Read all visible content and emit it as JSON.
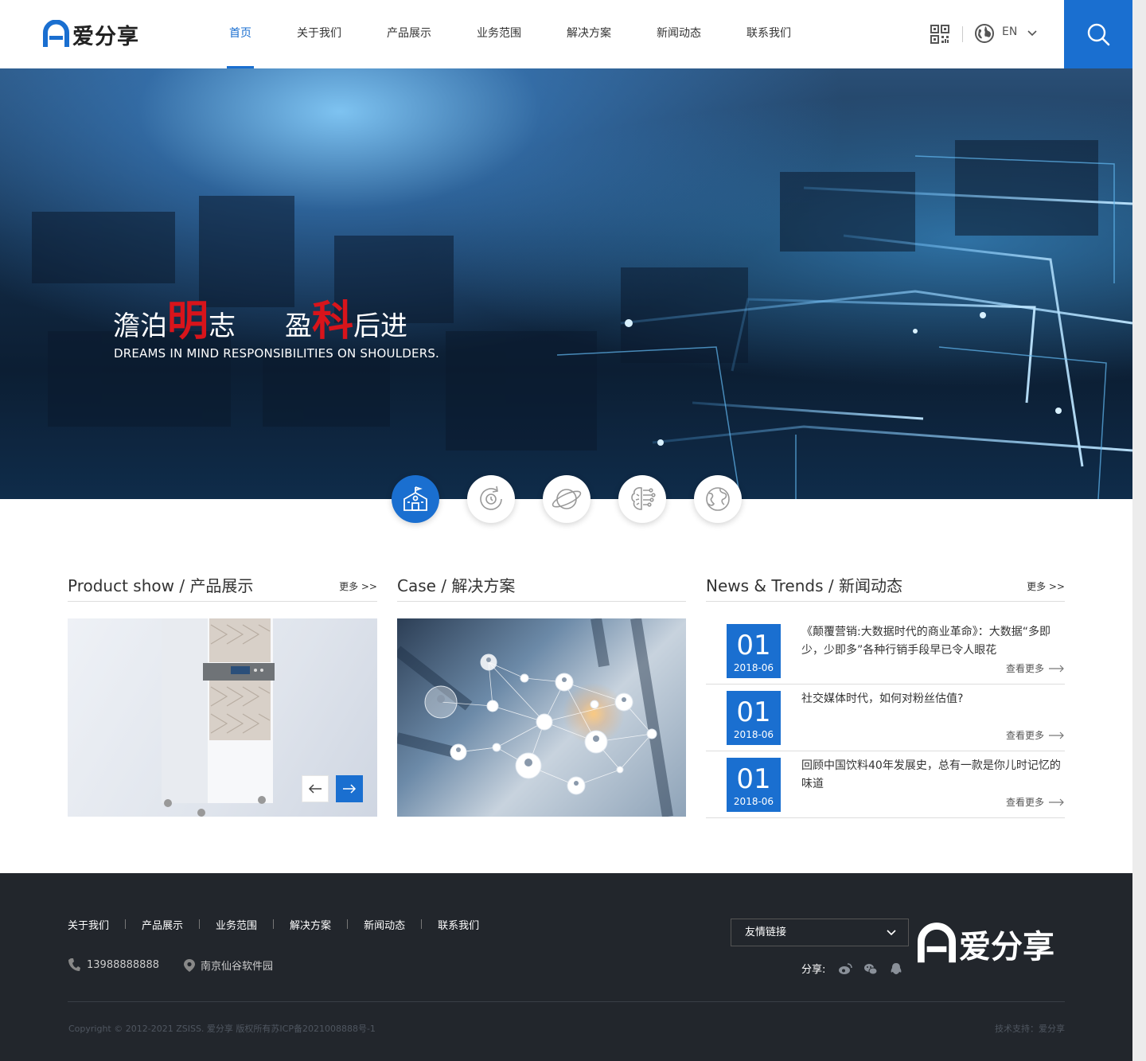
{
  "brand": {
    "name": "爱分享"
  },
  "nav": [
    {
      "label": "首页",
      "active": true
    },
    {
      "label": "关于我们"
    },
    {
      "label": "产品展示"
    },
    {
      "label": "业务范围"
    },
    {
      "label": "解决方案"
    },
    {
      "label": "新闻动态"
    },
    {
      "label": "联系我们"
    }
  ],
  "header": {
    "lang": "EN",
    "accent_color": "#1a6fd0"
  },
  "banner": {
    "slogan_part1": "澹泊",
    "slogan_red1": "明",
    "slogan_part2": "志",
    "slogan_part3": "盈",
    "slogan_red2": "科",
    "slogan_part4": "后进",
    "subtitle": "DREAMS IN MIND  RESPONSIBILITIES ON SHOULDERS.",
    "circle_icons": [
      "school-icon",
      "refresh-icon",
      "planet-icon",
      "brain-icon",
      "earth-icon"
    ],
    "highlight_color": "#d8141b"
  },
  "products": {
    "title": "Product show / 产品展示",
    "more": "更多 >>"
  },
  "cases": {
    "title": "Case / 解决方案"
  },
  "news": {
    "title": "News & Trends / 新闻动态",
    "more": "更多 >>",
    "items": [
      {
        "day": "01",
        "ym": "2018-06",
        "title": "《颠覆营销:大数据时代的商业革命》：大数据“多即少，少即多”各种行销手段早已令人眼花",
        "more": "查看更多"
      },
      {
        "day": "01",
        "ym": "2018-06",
        "title": "社交媒体时代，如何对粉丝估值?",
        "more": "查看更多"
      },
      {
        "day": "01",
        "ym": "2018-06",
        "title": "回顾中国饮料40年发展史，总有一款是你儿时记忆的味道",
        "more": "查看更多"
      }
    ]
  },
  "footer": {
    "nav": [
      "关于我们",
      "产品展示",
      "业务范围",
      "解决方案",
      "新闻动态",
      "联系我们"
    ],
    "phone": "13988888888",
    "address": "南京仙谷软件园",
    "links_select": "友情链接",
    "share_label": "分享:",
    "copyright": "Copyright © 2012-2021 ZSISS. 爱分享 版权所有苏ICP备2021008888号-1",
    "tech": "技术支持：爱分享"
  }
}
